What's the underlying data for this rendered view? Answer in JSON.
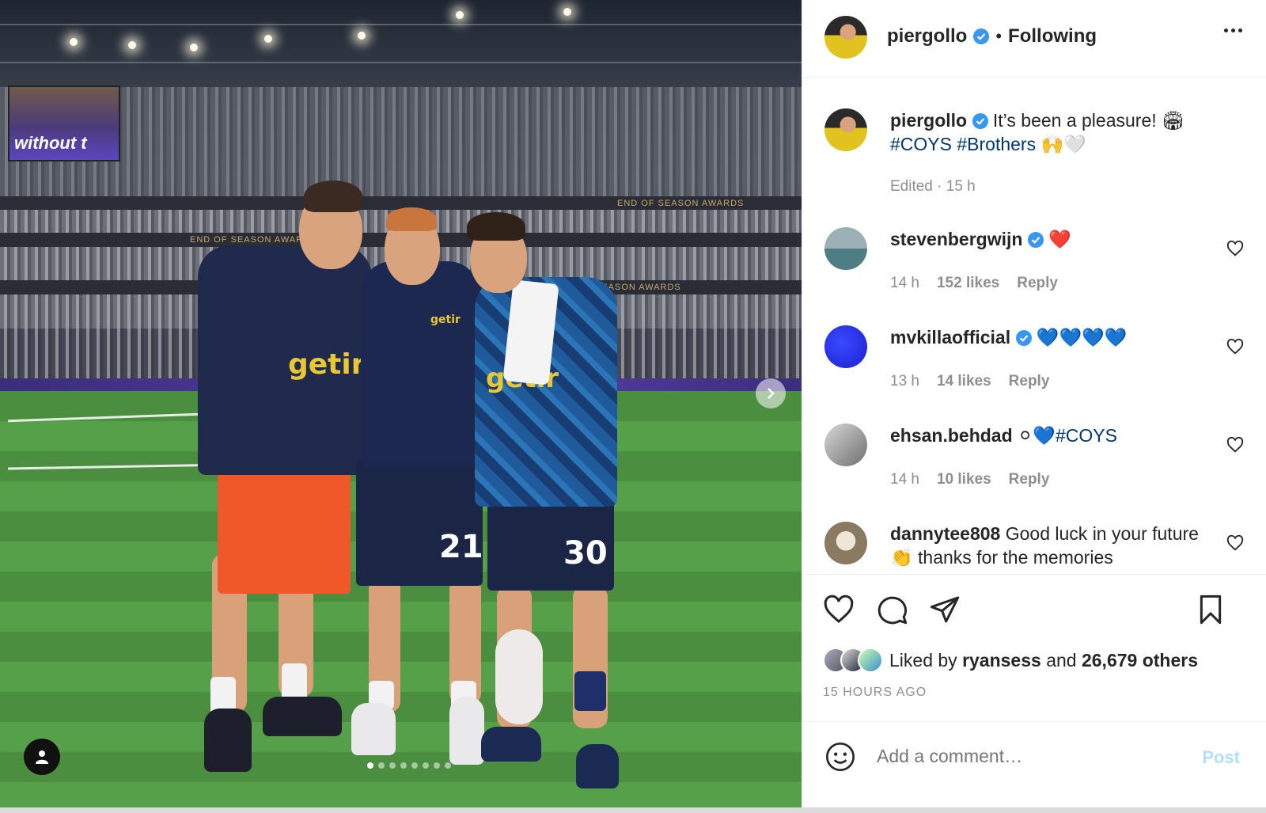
{
  "post": {
    "owner": "piergollo",
    "follow_separator": "•",
    "follow_status": "Following",
    "caption_text": "It’s been a pleasure! 🏟",
    "caption_tags": "#COYS #Brothers",
    "caption_emoji": "🙌🤍",
    "edited_time": "Edited · 15 h",
    "photo_text": {
      "screen": "without t",
      "banner_1": "END OF SEASON AWARDS",
      "banner_2": "END OF SEASON AWARDS",
      "banner_3": "SEASON AWARDS",
      "sponsor": "getir",
      "number_a": "21",
      "number_b": "30"
    },
    "carousel": {
      "count": 8,
      "active": 1
    }
  },
  "comments": [
    {
      "user": "stevenbergwijn",
      "verified": true,
      "text": "❤️",
      "time": "14 h",
      "likes": "152 likes",
      "reply": "Reply"
    },
    {
      "user": "mvkillaofficial",
      "verified": true,
      "text": "💙💙💙💙",
      "time": "13 h",
      "likes": "14 likes",
      "reply": "Reply"
    },
    {
      "user": "ehsan.behdad",
      "verified": false,
      "text_emoji": "⚪💙",
      "text_tag": "#COYS",
      "time": "14 h",
      "likes": "10 likes",
      "reply": "Reply"
    },
    {
      "user": "dannytee808",
      "verified": false,
      "text": "Good luck in your future 👏 thanks for the memories"
    }
  ],
  "likes": {
    "prefix": "Liked by",
    "user": "ryansess",
    "middle": "and",
    "others": "26,679 others"
  },
  "time_ago": "15 HOURS AGO",
  "comment_box": {
    "placeholder": "Add a comment…",
    "post_label": "Post"
  },
  "colors": {
    "link": "#00376b",
    "verified": "#3897f0",
    "post_disabled": "#b2dffc",
    "meta": "#8e8e8e"
  },
  "icons": [
    "verified-icon",
    "more-icon",
    "heart-icon",
    "comment-icon",
    "share-icon",
    "bookmark-icon",
    "emoji-icon",
    "user-tag-icon",
    "chevron-right-icon"
  ]
}
